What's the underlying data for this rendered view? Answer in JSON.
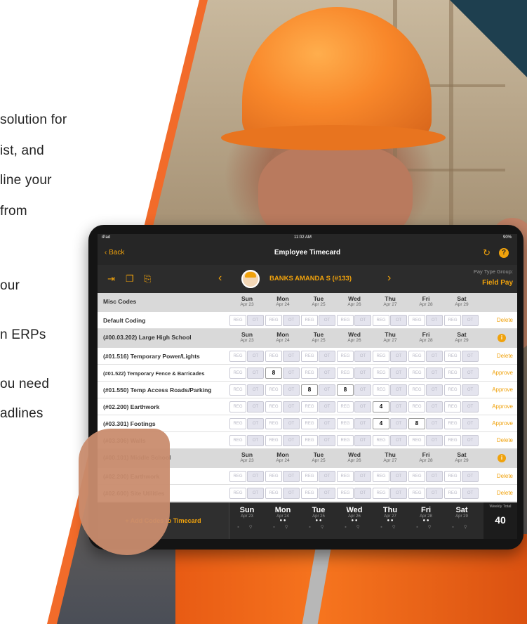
{
  "marketing": {
    "lines": [
      "solution for",
      "ist, and",
      "line your",
      "from",
      "our",
      "n ERPs",
      "ou need",
      "adlines"
    ]
  },
  "status_bar": {
    "device": "iPad",
    "time": "11:02 AM",
    "battery": "90%"
  },
  "nav": {
    "back_label": "Back",
    "title": "Employee Timecard",
    "refresh_icon": "refresh-icon",
    "help_icon": "help-icon"
  },
  "employee": {
    "name": "BANKS AMANDA S (#133)",
    "pay_type_label": "Pay Type Group:",
    "pay_type_value": "Field Pay"
  },
  "days": [
    {
      "name": "Sun",
      "date": "Apr 23"
    },
    {
      "name": "Mon",
      "date": "Apr 24"
    },
    {
      "name": "Tue",
      "date": "Apr 25"
    },
    {
      "name": "Wed",
      "date": "Apr 26"
    },
    {
      "name": "Thu",
      "date": "Apr 27"
    },
    {
      "name": "Fri",
      "date": "Apr 28"
    },
    {
      "name": "Sat",
      "date": "Apr 29"
    }
  ],
  "cell_labels": {
    "reg": "REG",
    "ot": "OT"
  },
  "rows": [
    {
      "type": "header",
      "label": "Misc Codes"
    },
    {
      "type": "code",
      "label": "Default Coding",
      "action": "Delete",
      "values": {}
    },
    {
      "type": "job",
      "label": "(#00.03.202) Large High School"
    },
    {
      "type": "code",
      "label": "(#01.516) Temporary Power/Lights",
      "action": "Delete",
      "values": {}
    },
    {
      "type": "code",
      "label": "(#01.522) Temporary Fence & Barricades",
      "small": true,
      "action": "Approve",
      "values": {
        "1": "8"
      }
    },
    {
      "type": "code",
      "label": "(#01.550) Temp Access Roads/Parking",
      "action": "Approve",
      "values": {
        "2": "8",
        "3": "8"
      }
    },
    {
      "type": "code",
      "label": "(#02.200) Earthwork",
      "action": "Approve",
      "values": {
        "4": "4"
      }
    },
    {
      "type": "code",
      "label": "(#03.301) Footings",
      "action": "Approve",
      "values": {
        "4": "4",
        "5": "8"
      }
    },
    {
      "type": "code",
      "label": "(#03.306) Walls",
      "action": "Delete",
      "values": {}
    },
    {
      "type": "job",
      "label": "(#00.101) Middle School"
    },
    {
      "type": "code",
      "label": "(#02.200) Earthwork",
      "action": "Delete",
      "values": {}
    },
    {
      "type": "code",
      "label": "(#02.600) Site Utilities",
      "action": "Delete",
      "values": {}
    }
  ],
  "footer": {
    "add_codes_label": "+ Add Codes to Timecard",
    "weekly_total_label": "Weekly Total",
    "weekly_total_value": "40",
    "day_dots": [
      "",
      "● ●",
      "● ●",
      "● ●",
      "● ●",
      "● ●",
      ""
    ],
    "day_icons": "▪ ⚲"
  },
  "colors": {
    "accent": "#f0a20c",
    "brand_orange": "#f26b2a",
    "dark_bar": "#262626"
  }
}
